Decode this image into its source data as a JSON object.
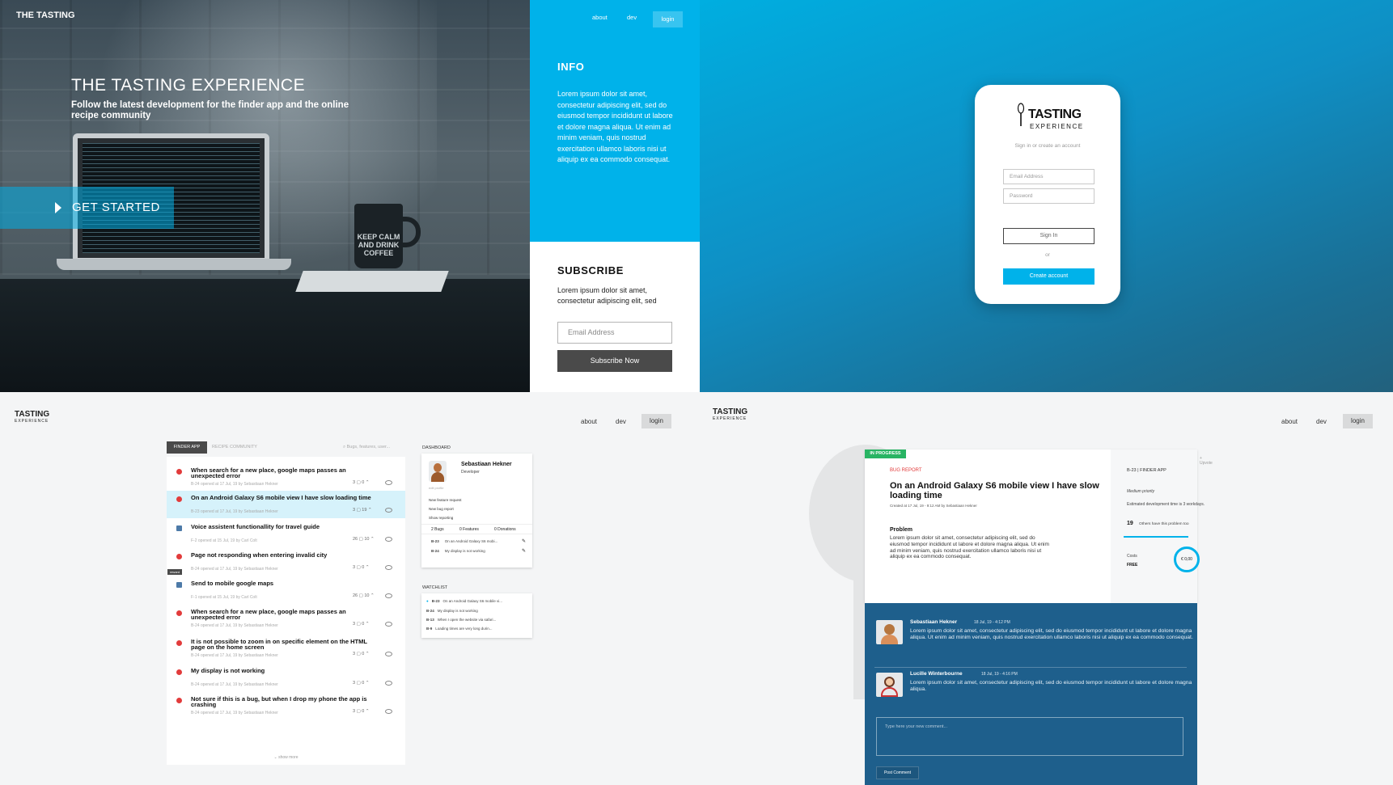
{
  "hero": {
    "logo": "THE TASTING",
    "title": "THE TASTING EXPERIENCE",
    "subtitle": "Follow the latest development for the finder app and the online recipe community",
    "cta": "GET STARTED",
    "mug_text": "KEEP CALM AND DRINK COFFEE"
  },
  "nav": {
    "about": "about",
    "dev": "dev",
    "login": "login"
  },
  "info": {
    "title": "INFO",
    "body": "Lorem ipsum dolor sit amet, consectetur adipiscing elit, sed do eiusmod tempor incididunt ut labore et dolore magna aliqua. Ut enim ad minim veniam, quis nostrud exercitation ullamco laboris nisi ut aliquip ex ea commodo consequat."
  },
  "subscribe": {
    "title": "SUBSCRIBE",
    "body": "Lorem ipsum dolor sit amet, consectetur adipiscing elit, sed",
    "email_placeholder": "Email Address",
    "button": "Subscribe Now"
  },
  "login": {
    "logo_line1": "TASTING",
    "logo_line2": "EXPERIENCE",
    "hint": "Sign in or create an account",
    "email_placeholder": "Email Address",
    "password_placeholder": "Password",
    "signin": "Sign In",
    "or": "or",
    "create": "Create account"
  },
  "dashboard": {
    "logo": "TASTING",
    "logo_sub": "EXPERIENCE",
    "tab_active": "FINDER APP",
    "tab_inactive": "RECIPE COMMUNITY",
    "search_placeholder": "Bugs, features, user...",
    "bugs": [
      {
        "title": "When search for a new place, google maps passes an unexpected error",
        "meta": "B-24 opened at 17 Jul, 19 by Sebastiaan Hekner",
        "stats": "3 ▢  0 ⌃",
        "type": "bug",
        "highlight": false
      },
      {
        "title": "On an Android Galaxy S6 mobile view I have slow loading time",
        "meta": "B-23 opened at 17 Jul, 19 by Sebastiaan Hekner",
        "stats": "3 ▢  19 ⌃",
        "type": "bug",
        "highlight": true
      },
      {
        "title": "Voice assistent functionallity for travel guide",
        "meta": "F-2 opened at 15 Jul, 19 by Carl Colt",
        "stats": "26 ▢  10 ⌃",
        "type": "feature",
        "highlight": false
      },
      {
        "title": "Page not responding when entering invalid city",
        "meta": "B-24 opened at 17 Jul, 19 by Sebastiaan Hekner",
        "stats": "3 ▢  0 ⌃",
        "type": "bug",
        "highlight": false
      },
      {
        "title": "Send to mobile google maps",
        "meta": "F-1 opened at 15 Jul, 19 by Carl Colt",
        "stats": "26 ▢  10 ⌃",
        "type": "feature",
        "highlight": false
      },
      {
        "title": "When search for a new place, google maps passes an unexpected error",
        "meta": "B-24 opened at 17 Jul, 19 by Sebastiaan Hekner",
        "stats": "3 ▢  0 ⌃",
        "type": "bug",
        "highlight": false
      },
      {
        "title": "It is not possible to zoom in on specific element on the HTML page on the home screen",
        "meta": "B-24 opened at 17 Jul, 19 by Sebastiaan Hekner",
        "stats": "3 ▢  0 ⌃",
        "type": "bug",
        "highlight": false
      },
      {
        "title": "My display is not working",
        "meta": "B-24 opened at 17 Jul, 19 by Sebastiaan Hekner",
        "stats": "3 ▢  0 ⌃",
        "type": "bug",
        "highlight": false
      },
      {
        "title": "Not sure if this is a bug, but when I drop my phone the app is crashing",
        "meta": "B-24 opened at 17 Jul, 19 by Sebastiaan Hekner",
        "stats": "3 ▢  0 ⌃",
        "type": "bug",
        "highlight": false
      }
    ],
    "show_more": "show more",
    "side_tag": "reward",
    "dashboard_label": "DASHBOARD",
    "profile_name": "Sebastiaan Hekner",
    "profile_role": "Developer",
    "edit_profile": "edit profile",
    "links": [
      "New feature request",
      "New bug report",
      "Show reporting"
    ],
    "stat_bugs": "2 Bugs",
    "stat_features": "0 Features",
    "stat_donations": "0 Donations",
    "my_items": [
      {
        "id": "B-23",
        "text": "On an Android Galaxy S6 mobi..."
      },
      {
        "id": "B-24",
        "text": "My display is not working"
      }
    ],
    "watchlist_label": "WATCHLIST",
    "watchlist": [
      {
        "id": "B-23",
        "text": "On an Android Galaxy S6 mobile vi..."
      },
      {
        "id": "B-24",
        "text": "My display is not working"
      },
      {
        "id": "B-13",
        "text": "When I open the website via safari..."
      },
      {
        "id": "B-9",
        "text": "Loading times are very long durin..."
      }
    ]
  },
  "detail": {
    "status": "IN PROGRESS",
    "label": "BUG REPORT",
    "title": "On an Android Galaxy S6 mobile view I have slow loading time",
    "created": "Created at 17 Jul, 19 - 9:12 AM by Sebastiaan Hekner",
    "problem_label": "Problem",
    "problem": "Lorem ipsum dolor sit amet, consectetur adipiscing elit, sed do eiusmod tempor incididunt ut labore et dolore magna aliqua. Ut enim ad minim veniam, quis nostrud exercitation ullamco laboris nisi ut aliquip ex ea commodo consequat.",
    "upvote": "+ Upvote",
    "id_app": "B-23 | FINDER APP",
    "priority": "Medium priority",
    "estimate": "Estimated development time is 3 workdays.",
    "others_count": "19",
    "others_text": "Others have this problem too",
    "costs_label": "Costs",
    "costs_value": "FREE",
    "amount": "€ 0,00",
    "comments": [
      {
        "name": "Sebastiaan Hekner",
        "date": "18 Jul, 19 - 4:12 PM",
        "text": "Lorem ipsum dolor sit amet, consectetur adipiscing elit, sed do eiusmod tempor incididunt ut labore et dolore magna aliqua. Ut enim ad minim veniam, quis nostrud exercitation ullamco laboris nisi ut aliquip ex ea commodo consequat."
      },
      {
        "name": "Lucille Winterbourne",
        "date": "18 Jul, 19 - 4:16 PM",
        "text": "Lorem ipsum dolor sit amet, consectetur adipiscing elit, sed do eiusmod tempor incididunt ut labore et dolore magna aliqua."
      }
    ],
    "comment_placeholder": "Type here your new comment...",
    "post_button": "Post Comment"
  },
  "colors": {
    "accent": "#00b2ea",
    "dark": "#4a4a4a",
    "comments_bg": "#1e5f8c",
    "progress": "#28b463",
    "bug": "#e23b3b"
  }
}
